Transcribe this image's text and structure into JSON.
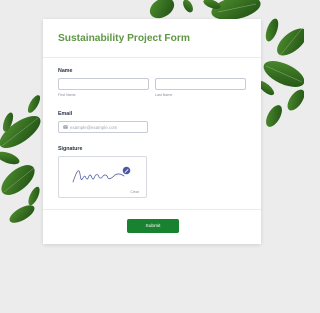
{
  "form": {
    "title": "Sustainability Project Form",
    "name": {
      "label": "Name",
      "first_sublabel": "First Name",
      "last_sublabel": "Last Name"
    },
    "email": {
      "label": "Email",
      "placeholder": "example@example.com",
      "icon": "envelope-icon"
    },
    "signature": {
      "label": "Signature",
      "clear_label": "Clear",
      "pen_icon": "pen-icon"
    },
    "submit_label": "Submit"
  },
  "colors": {
    "title": "#5f9744",
    "submit": "#198231",
    "background": "#ececec",
    "leaf": "#2f6b1f"
  }
}
